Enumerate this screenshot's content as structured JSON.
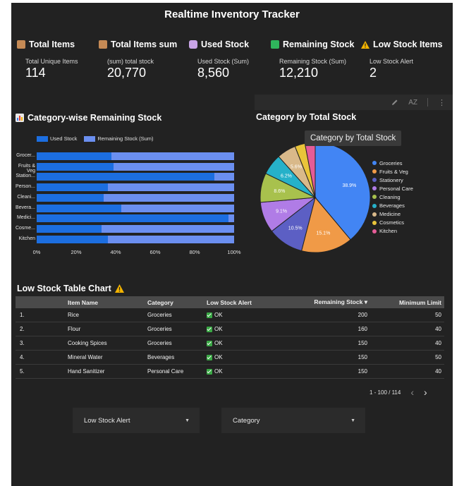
{
  "title": "Realtime Inventory Tracker",
  "kpis": [
    {
      "label": "Total Items",
      "icon": "package-icon",
      "icon_color": "#c58a55",
      "sub": "Total Unique Items",
      "value": "114"
    },
    {
      "label": "Total Items sum",
      "icon": "package-icon",
      "icon_color": "#c58a55",
      "sub": "(sum) total stock",
      "value": "20,770"
    },
    {
      "label": "Used Stock",
      "icon": "jar-icon",
      "icon_color": "#c9a4e6",
      "sub": "Used Stock (Sum)",
      "value": "8,560"
    },
    {
      "label": "Remaining Stock",
      "icon": "green-square-icon",
      "icon_color": "#2fb65c",
      "sub": "Remaining Stock (Sum)",
      "value": "12,210"
    },
    {
      "label": "Low Stock Items",
      "icon": "warning-icon",
      "icon_color": "#f4b400",
      "sub": "Low Stock Alert",
      "value": "2"
    }
  ],
  "toolbar": {
    "edit_icon": "pencil-icon",
    "sort_label": "AZ",
    "more_icon": "more-vert-icon"
  },
  "bar_section": {
    "title": "Category-wise Remaining Stock",
    "icon": "bar-chart-icon"
  },
  "pie_section": {
    "title": "Category by Total Stock",
    "tooltip": "Category by Total Stock"
  },
  "chart_data": [
    {
      "type": "bar",
      "orientation": "horizontal",
      "stacked": "percent",
      "categories": [
        "Grocer...",
        "Fruits & Veg",
        "Station...",
        "Person...",
        "Cleani...",
        "Bevera...",
        "Medici...",
        "Cosme...",
        "Kitchen"
      ],
      "series": [
        {
          "name": "Used Stock",
          "color": "#1c6ee0",
          "values": [
            38,
            39,
            90,
            36,
            34,
            43,
            97,
            33,
            36
          ]
        },
        {
          "name": "Remaining Stock (Sum)",
          "color": "#6b8ff0",
          "values": [
            62,
            61,
            10,
            64,
            66,
            57,
            3,
            67,
            64
          ]
        }
      ],
      "xticks": [
        "0%",
        "20%",
        "40%",
        "60%",
        "80%",
        "100%"
      ],
      "xlim": [
        0,
        100
      ],
      "legend": "top"
    },
    {
      "type": "pie",
      "slices": [
        {
          "name": "Groceries",
          "value": 38.9,
          "label": "38.9%",
          "color": "#4285f4"
        },
        {
          "name": "Fruits & Veg",
          "value": 15.1,
          "label": "15.1%",
          "color": "#f09a47"
        },
        {
          "name": "Stationery",
          "value": 10.5,
          "label": "10.5%",
          "color": "#5c5fc4"
        },
        {
          "name": "Personal Care",
          "value": 9.1,
          "label": "9.1%",
          "color": "#b07ce6"
        },
        {
          "name": "Cleaning",
          "value": 8.6,
          "label": "8.6%",
          "color": "#a8c14d"
        },
        {
          "name": "Beverages",
          "value": 6.2,
          "label": "6.2%",
          "color": "#26b1c9"
        },
        {
          "name": "Medicine",
          "value": 5.6,
          "label": "5.6%",
          "color": "#d9b98a"
        },
        {
          "name": "Cosmetics",
          "value": 3.0,
          "label": "",
          "color": "#e9c43a"
        },
        {
          "name": "Kitchen",
          "value": 3.0,
          "label": "",
          "color": "#e55c97"
        }
      ],
      "legend": "right"
    }
  ],
  "table": {
    "title": "Low Stock Table Chart",
    "columns": [
      "Item Name",
      "Category",
      "Low Stock Alert",
      "Remaining Stock",
      "Minimum Limit"
    ],
    "sort_indicator": "▾",
    "rows": [
      {
        "n": "1.",
        "item": "Rice",
        "category": "Groceries",
        "alert": "OK",
        "remaining": "200",
        "min": "50"
      },
      {
        "n": "2.",
        "item": "Flour",
        "category": "Groceries",
        "alert": "OK",
        "remaining": "160",
        "min": "40"
      },
      {
        "n": "3.",
        "item": "Cooking Spices",
        "category": "Groceries",
        "alert": "OK",
        "remaining": "150",
        "min": "40"
      },
      {
        "n": "4.",
        "item": "Mineral Water",
        "category": "Beverages",
        "alert": "OK",
        "remaining": "150",
        "min": "50"
      },
      {
        "n": "5.",
        "item": "Hand Sanitizer",
        "category": "Personal Care",
        "alert": "OK",
        "remaining": "150",
        "min": "40"
      }
    ],
    "pagination": "1 - 100 / 114"
  },
  "filters": [
    {
      "label": "Low Stock Alert"
    },
    {
      "label": "Category"
    }
  ]
}
